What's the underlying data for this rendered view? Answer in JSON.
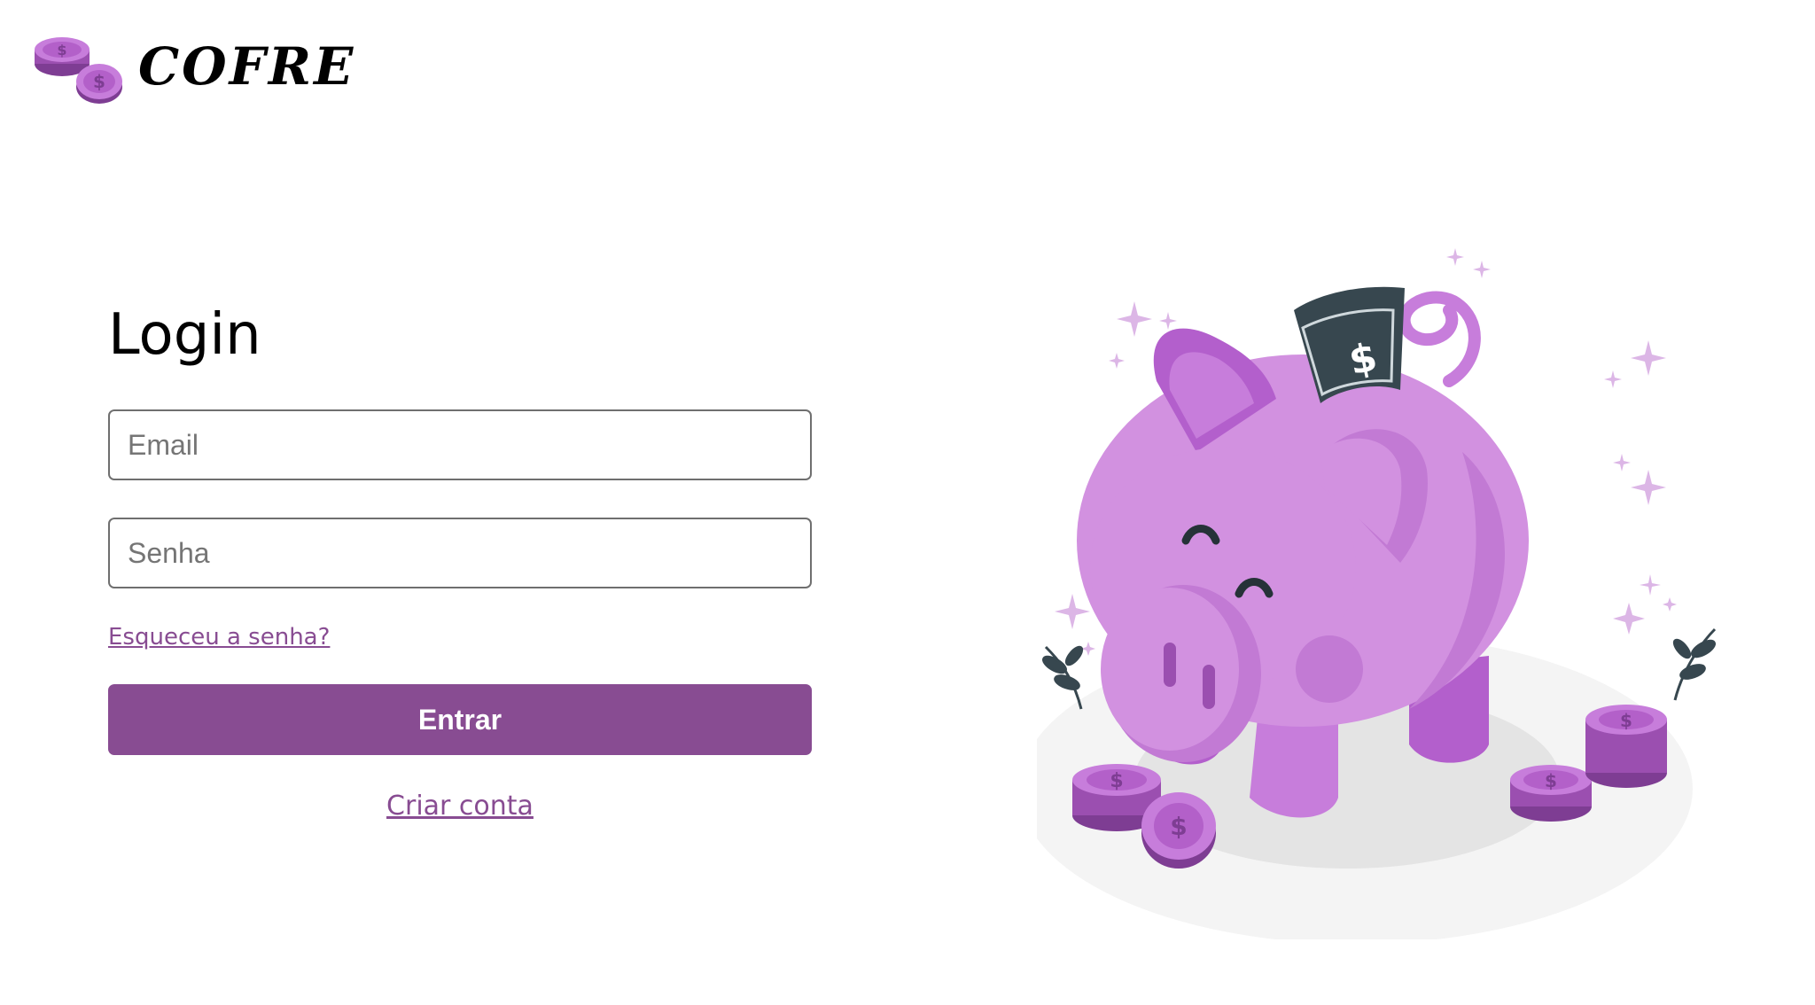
{
  "brand": {
    "name": "COFRE",
    "logo_icon": "coin-stack-icon",
    "accent_color": "#884c92"
  },
  "login": {
    "title": "Login",
    "email_placeholder": "Email",
    "email_value": "",
    "password_placeholder": "Senha",
    "password_value": "",
    "forgot_password_label": "Esqueceu a senha?",
    "submit_label": "Entrar",
    "signup_label": "Criar conta"
  },
  "illustration": {
    "icon": "piggy-bank-illustration",
    "banknote_symbol": "$",
    "coin_symbol": "$"
  }
}
